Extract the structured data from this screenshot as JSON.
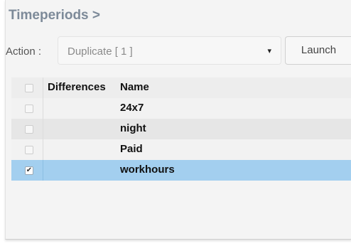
{
  "header": {
    "title": "Timeperiods >"
  },
  "action": {
    "label": "Action :",
    "selected": "Duplicate [ 1 ]",
    "dropdown_arrow": "▾",
    "launch_label": "Launch"
  },
  "table": {
    "columns": [
      "Differences",
      "Name"
    ],
    "rows": [
      {
        "name": "24x7",
        "checked": false
      },
      {
        "name": "night",
        "checked": false
      },
      {
        "name": "Paid",
        "checked": false
      },
      {
        "name": "workhours",
        "checked": true,
        "check_glyph": "✔"
      }
    ]
  },
  "colors": {
    "title": "#7d8a99",
    "selected_row": "#a3cfef"
  },
  "icons": {
    "dropdown": "caret-down-icon",
    "check": "checkmark-icon"
  }
}
